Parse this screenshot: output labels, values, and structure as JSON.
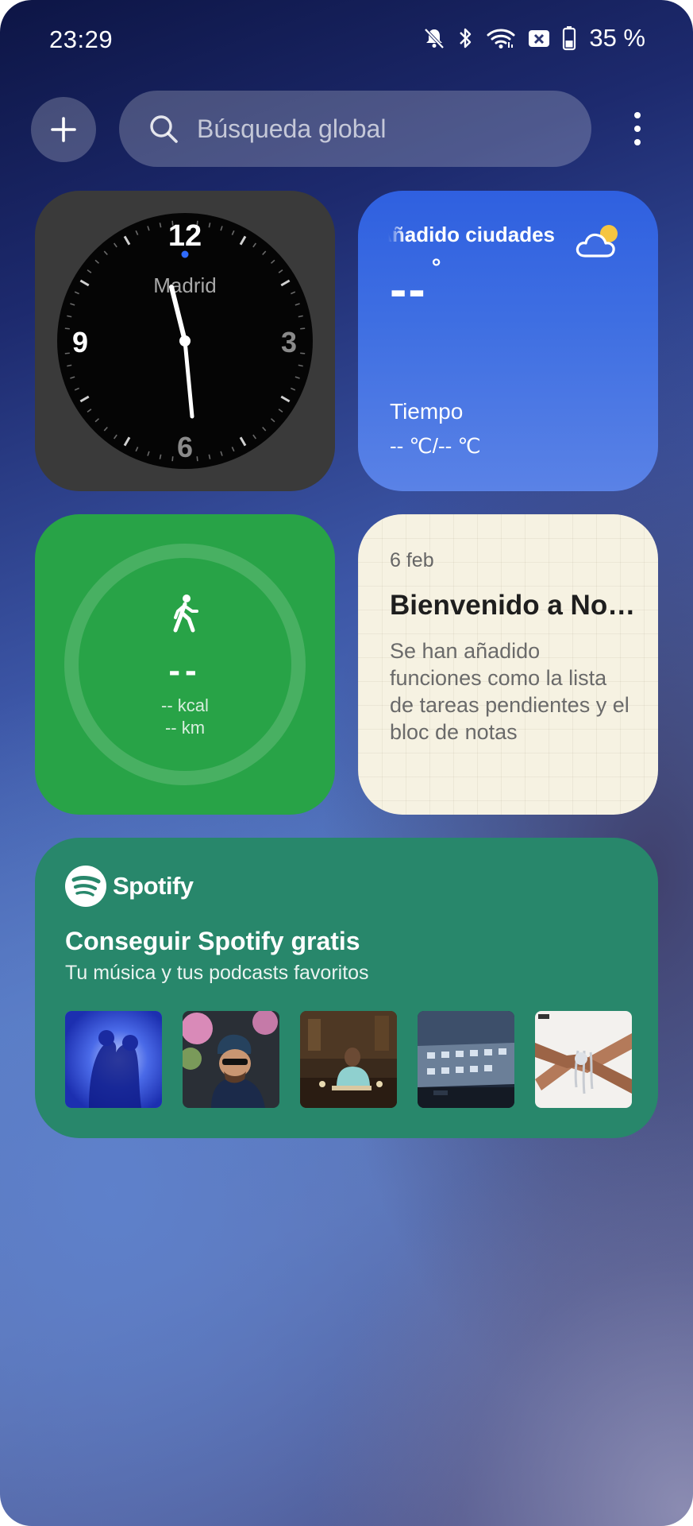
{
  "status_bar": {
    "time": "23:29",
    "battery": "35 %",
    "icons": [
      "mute-icon",
      "bluetooth-icon",
      "wifi-icon",
      "sim-off-icon",
      "battery-icon"
    ]
  },
  "top_bar": {
    "add_icon": "plus-icon",
    "search_placeholder": "Búsqueda global",
    "more_icon": "more-vertical-icon"
  },
  "clock_widget": {
    "city": "Madrid",
    "numerals": {
      "twelve": "12",
      "three": "3",
      "six": "6",
      "nine": "9"
    },
    "time_shown": "23:29"
  },
  "weather_widget": {
    "cities_label": "Añadido ciudades",
    "temperature": "--",
    "degree": "°",
    "app_label": "Tiempo",
    "range": "-- ℃/-- ℃",
    "icon": "partly-cloudy-icon"
  },
  "steps_widget": {
    "count": "--",
    "kcal": "-- kcal",
    "km": "-- km",
    "icon": "walking-icon"
  },
  "notes_widget": {
    "date": "6 feb",
    "title": "Bienvenido a Notas",
    "body": "Se han añadido funciones como la lista de tareas pendientes y el bloc de notas"
  },
  "spotify_widget": {
    "brand": "Spotify",
    "title": "Conseguir Spotify gratis",
    "subtitle": "Tu música y tus podcasts favoritos",
    "albums": [
      "album-1",
      "album-2",
      "album-3",
      "album-4",
      "album-5"
    ]
  }
}
